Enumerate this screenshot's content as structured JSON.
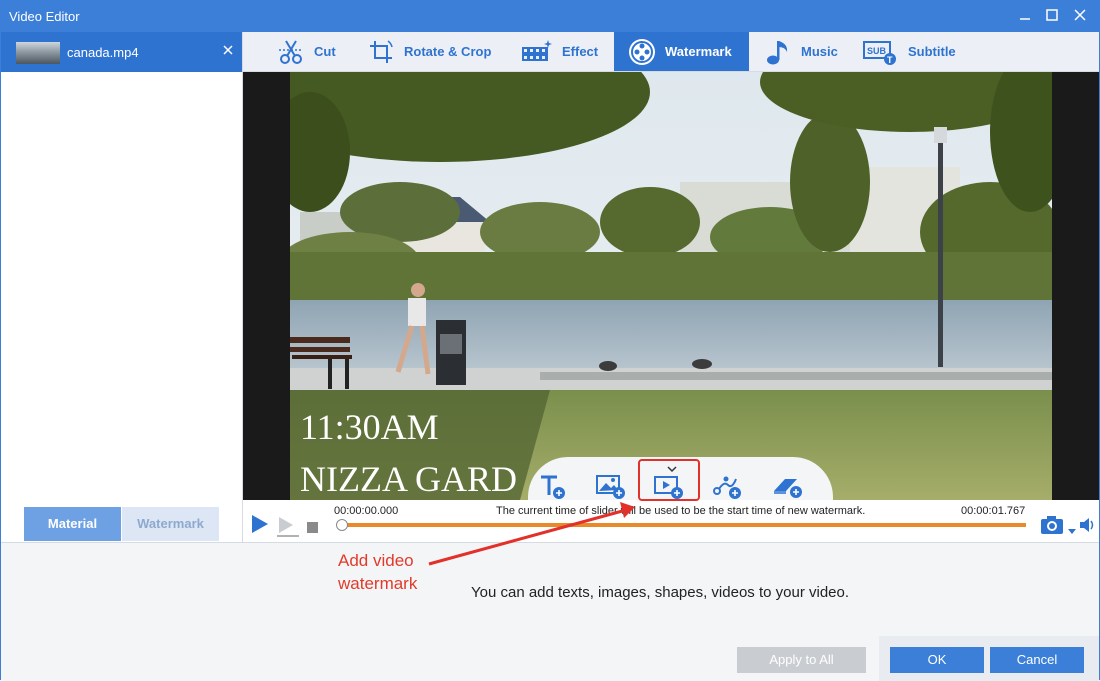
{
  "window": {
    "title": "Video Editor"
  },
  "file": {
    "name": "canada.mp4"
  },
  "left_tabs": [
    {
      "label": "Material"
    },
    {
      "label": "Watermark"
    }
  ],
  "toolbar": {
    "tabs": [
      {
        "label": "Cut",
        "icon": "scissors-icon"
      },
      {
        "label": "Rotate & Crop",
        "icon": "crop-icon"
      },
      {
        "label": "Effect",
        "icon": "effect-icon"
      },
      {
        "label": "Watermark",
        "icon": "watermark-icon",
        "active": true
      },
      {
        "label": "Music",
        "icon": "music-note-icon"
      },
      {
        "label": "Subtitle",
        "icon": "subtitle-icon"
      }
    ]
  },
  "video": {
    "overlay_time": "11:30AM",
    "overlay_place": "NIZZA GARD"
  },
  "watermark_tools": [
    {
      "name": "add-text-watermark",
      "icon": "text-plus-icon"
    },
    {
      "name": "add-image-watermark",
      "icon": "image-plus-icon"
    },
    {
      "name": "add-video-watermark",
      "icon": "video-plus-icon"
    },
    {
      "name": "add-shape-watermark",
      "icon": "shape-plus-icon"
    },
    {
      "name": "add-eraser-watermark",
      "icon": "eraser-plus-icon"
    }
  ],
  "playback": {
    "current_time": "00:00:00.000",
    "end_time": "00:00:01.767",
    "hint": "The current time of slider will be used to be the start time of new watermark.",
    "progress": 0
  },
  "message": "You can add texts, images, shapes, videos to your video.",
  "buttons": {
    "apply_all": "Apply to All",
    "ok": "OK",
    "cancel": "Cancel"
  },
  "annotation": {
    "line1": "Add video",
    "line2": "watermark"
  },
  "colors": {
    "accent": "#3b7fd9",
    "active_tab": "#2f73d1",
    "progress": "#e8892a",
    "annotation": "#e23a2a"
  }
}
